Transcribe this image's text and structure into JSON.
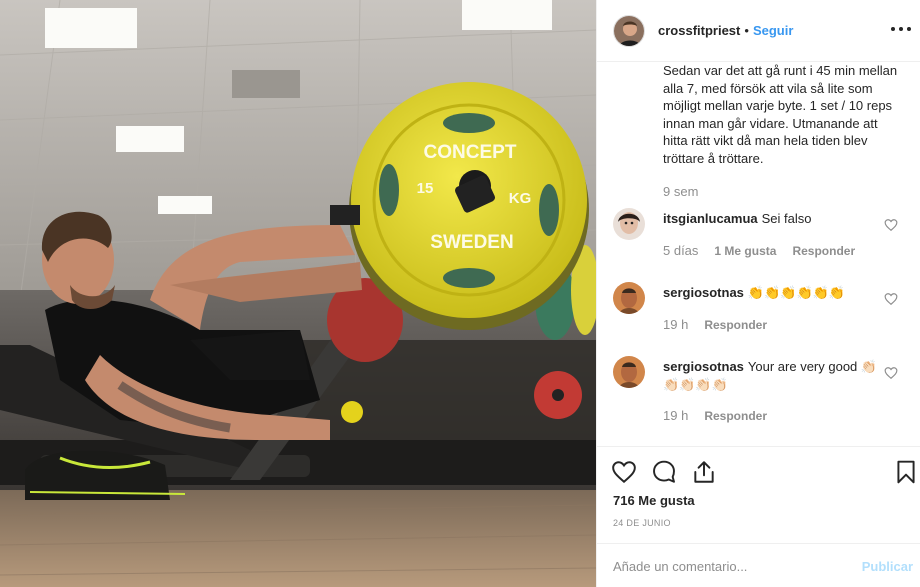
{
  "photo": {
    "plate_text_top": "CONCEPT",
    "plate_text_left": "15",
    "plate_text_right": "KG",
    "plate_text_bottom": "SWEDEN",
    "plate_color": "#e6db2c"
  },
  "post": {
    "username": "crossfitpriest",
    "separator": "•",
    "follow_label": "Seguir",
    "caption": "Sedan var det att gå runt i 45 min mellan alla 7, med försök att vila så lite som möjligt mellan varje byte. 1 set / 10 reps innan man går vidare. Utmanande att hitta rätt vikt då man hela tiden blev tröttare å tröttare.",
    "caption_time": "9 sem"
  },
  "comments": [
    {
      "user": "itsgianlucamua",
      "text": "Sei falso",
      "time": "5 días",
      "likes": "1 Me gusta",
      "reply": "Responder"
    },
    {
      "user": "sergiosotnas",
      "text": "👏👏👏👏👏👏",
      "time": "19 h",
      "likes": "",
      "reply": "Responder"
    },
    {
      "user": "sergiosotnas",
      "text": "Your are very good 👏🏻👏🏻👏🏻👏🏻👏🏻",
      "time": "19 h",
      "likes": "",
      "reply": "Responder"
    }
  ],
  "actions": {
    "likes_count": "716 Me gusta",
    "post_date": "24 DE JUNIO",
    "comment_placeholder": "Añade un comentario...",
    "publish_label": "Publicar"
  },
  "colors": {
    "accent": "#3897f0",
    "muted": "#8e8e8e",
    "publish_disabled": "#b2dffc",
    "border": "#efefef"
  },
  "icons": [
    "more-icon",
    "heart-icon",
    "comment-icon",
    "share-icon",
    "bookmark-icon",
    "comment-like-icon"
  ]
}
